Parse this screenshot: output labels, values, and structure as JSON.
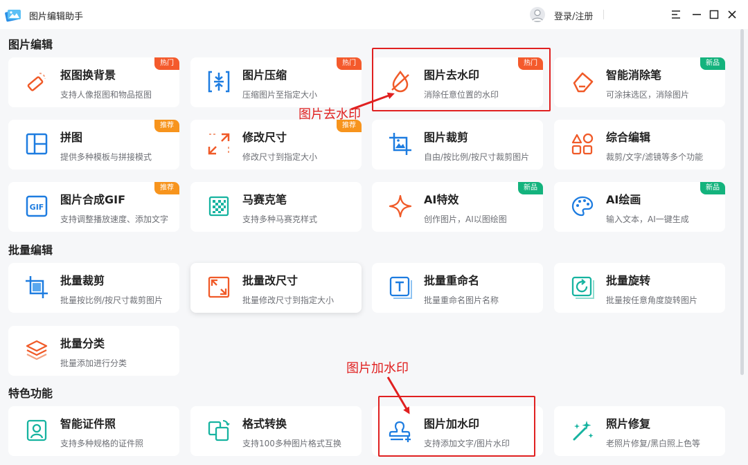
{
  "titlebar": {
    "app_title": "图片编辑助手",
    "login_label": "登录/注册"
  },
  "sections": {
    "edit": "图片编辑",
    "batch": "批量编辑",
    "feature": "特色功能"
  },
  "cards": {
    "matting": {
      "name": "抠图换背景",
      "desc": "支持人像抠图和物品抠图",
      "badge": "热门"
    },
    "compress": {
      "name": "图片压缩",
      "desc": "压缩图片至指定大小",
      "badge": "热门"
    },
    "watermark_remove": {
      "name": "图片去水印",
      "desc": "消除任意位置的水印",
      "badge": "热门"
    },
    "eraser": {
      "name": "智能消除笔",
      "desc": "可涂抹选区，消除图片",
      "badge": "新品"
    },
    "collage": {
      "name": "拼图",
      "desc": "提供多种模板与拼接模式",
      "badge": "推荐"
    },
    "resize": {
      "name": "修改尺寸",
      "desc": "修改尺寸到指定大小",
      "badge": "推荐"
    },
    "crop": {
      "name": "图片裁剪",
      "desc": "自由/按比例/按尺寸裁剪图片"
    },
    "combo": {
      "name": "综合编辑",
      "desc": "裁剪/文字/滤镜等多个功能"
    },
    "gif": {
      "name": "图片合成GIF",
      "desc": "支持调整播放速度、添加文字",
      "badge": "推荐"
    },
    "mosaic": {
      "name": "马赛克笔",
      "desc": "支持多种马赛克样式"
    },
    "ai_effects": {
      "name": "AI特效",
      "desc": "创作图片，AI以图绘图",
      "badge": "新品"
    },
    "ai_paint": {
      "name": "AI绘画",
      "desc": "输入文本，AI一键生成",
      "badge": "新品"
    },
    "batch_crop": {
      "name": "批量裁剪",
      "desc": "批量按比例/按尺寸裁剪图片"
    },
    "batch_resize": {
      "name": "批量改尺寸",
      "desc": "批量修改尺寸到指定大小"
    },
    "batch_rename": {
      "name": "批量重命名",
      "desc": "批量重命名图片名称"
    },
    "batch_rotate": {
      "name": "批量旋转",
      "desc": "批量按任意角度旋转图片"
    },
    "batch_classify": {
      "name": "批量分类",
      "desc": "批量添加进行分类"
    },
    "id_photo": {
      "name": "智能证件照",
      "desc": "支持多种规格的证件照"
    },
    "format": {
      "name": "格式转换",
      "desc": "支持100多种图片格式互换"
    },
    "watermark_add": {
      "name": "图片加水印",
      "desc": "支持添加文字/图片水印"
    },
    "restore": {
      "name": "照片修复",
      "desc": "老照片修复/黑白照上色等"
    }
  },
  "annotations": {
    "remove_watermark": "图片去水印",
    "add_watermark": "图片加水印"
  },
  "colors": {
    "accent_blue": "#1d7ce0",
    "accent_orange": "#f05a28",
    "accent_teal": "#16b3a0",
    "badge_hot": "#f45a2c",
    "badge_recommend": "#f7941d",
    "badge_new": "#14b37d",
    "annotation_red": "#e02020"
  }
}
